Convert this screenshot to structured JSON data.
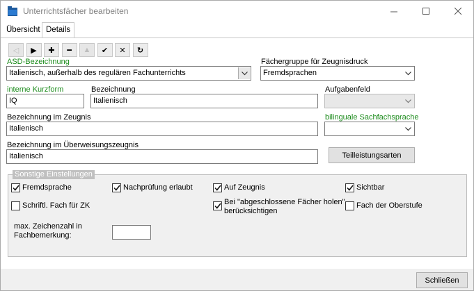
{
  "window": {
    "title": "Unterrichtsfächer bearbeiten"
  },
  "tabs": [
    {
      "label": "Übersicht"
    },
    {
      "label": "Details"
    }
  ],
  "toolbar": {
    "buttons": [
      {
        "icon": "first-icon",
        "glyph": "◁",
        "enabled": false
      },
      {
        "icon": "next-icon",
        "glyph": "▶",
        "enabled": true
      },
      {
        "icon": "add-icon",
        "glyph": "✚",
        "enabled": true
      },
      {
        "icon": "remove-icon",
        "glyph": "━",
        "enabled": true
      },
      {
        "icon": "warning-icon",
        "glyph": "▲",
        "enabled": false
      },
      {
        "icon": "check-icon",
        "glyph": "✔",
        "enabled": true
      },
      {
        "icon": "cancel-icon",
        "glyph": "✕",
        "enabled": true
      },
      {
        "icon": "refresh-icon",
        "glyph": "↻",
        "enabled": true
      }
    ]
  },
  "form": {
    "asd_label": "ASD-Bezeichnung",
    "asd_value": "Italienisch, außerhalb des regulären Fachunterrichts",
    "group_label": "Fächergruppe für Zeugnisdruck",
    "group_value": "Fremdsprachen",
    "short_label": "interne Kurzform",
    "short_value": "IQ",
    "name_label": "Bezeichnung",
    "name_value": "Italienisch",
    "task_label": "Aufgabenfeld",
    "task_value": "",
    "report_label": "Bezeichnung im Zeugnis",
    "report_value": "Italienisch",
    "bilingual_label": "bilinguale Sachfachsprache",
    "bilingual_value": "",
    "transfer_label": "Bezeichnung im Überweisungszeugnis",
    "transfer_value": "Italienisch",
    "partial_button": "Teilleistungsarten"
  },
  "settings": {
    "caption": "Sonstige Einstellungen",
    "checkboxes": [
      {
        "label": "Fremdsprache",
        "checked": true
      },
      {
        "label": "Nachprüfung erlaubt",
        "checked": true
      },
      {
        "label": "Auf Zeugnis",
        "checked": true
      },
      {
        "label": "Sichtbar",
        "checked": true
      },
      {
        "label": "Schriftl. Fach für ZK",
        "checked": false
      },
      {
        "label": "Bei \"abgeschlossene Fächer holen\" berücksichtigen",
        "checked": true
      },
      {
        "label": "Fach der Oberstufe",
        "checked": false
      }
    ],
    "maxchars_label": "max. Zeichenzahl in Fachbemerkung:",
    "maxchars_value": ""
  },
  "footer": {
    "close_label": "Schließen"
  }
}
